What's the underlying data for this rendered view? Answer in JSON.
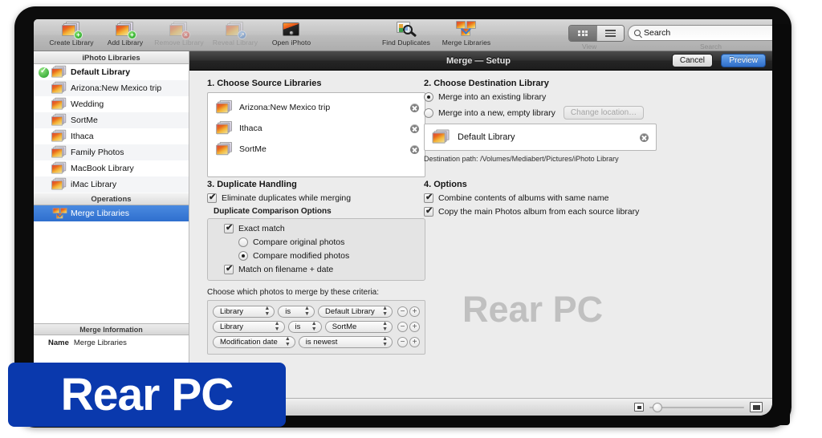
{
  "toolbar": {
    "items": [
      {
        "label": "Create Library",
        "icon": "photo-stack-add-icon",
        "enabled": true
      },
      {
        "label": "Add Library",
        "icon": "photo-stack-add-icon",
        "enabled": true
      },
      {
        "label": "Remove Library",
        "icon": "photo-stack-remove-icon",
        "enabled": false
      },
      {
        "label": "Reveal Library",
        "icon": "photo-stack-reveal-icon",
        "enabled": false
      },
      {
        "label": "Open iPhoto",
        "icon": "camera-icon",
        "enabled": true
      },
      {
        "label": "Find Duplicates",
        "icon": "magnifier-icon",
        "enabled": true
      },
      {
        "label": "Merge Libraries",
        "icon": "merge-icon",
        "enabled": true
      }
    ],
    "view_label": "View",
    "search_label": "Search",
    "search_value": "Search"
  },
  "sidebar": {
    "libraries_header": "iPhoto Libraries",
    "libraries": [
      {
        "name": "Default Library",
        "checked": true,
        "bold": true
      },
      {
        "name": "Arizona:New Mexico trip",
        "checked": false,
        "bold": false
      },
      {
        "name": "Wedding",
        "checked": false,
        "bold": false
      },
      {
        "name": "SortMe",
        "checked": false,
        "bold": false
      },
      {
        "name": "Ithaca",
        "checked": false,
        "bold": false
      },
      {
        "name": "Family Photos",
        "checked": false,
        "bold": false
      },
      {
        "name": "MacBook Library",
        "checked": false,
        "bold": false
      },
      {
        "name": "iMac Library",
        "checked": false,
        "bold": false
      }
    ],
    "operations_header": "Operations",
    "operations": [
      {
        "name": "Merge Libraries",
        "selected": true
      }
    ],
    "info_header": "Merge Information",
    "info_key": "Name",
    "info_value": "Merge Libraries"
  },
  "window": {
    "title": "Merge — Setup",
    "cancel_label": "Cancel",
    "preview_label": "Preview"
  },
  "section1": {
    "title": "1. Choose Source Libraries",
    "sources": [
      {
        "name": "Arizona:New Mexico trip"
      },
      {
        "name": "Ithaca"
      },
      {
        "name": "SortMe"
      }
    ]
  },
  "section2": {
    "title": "2. Choose Destination Library",
    "radio_existing": "Merge into an existing library",
    "radio_new": "Merge into a new, empty library",
    "existing_selected": true,
    "change_location_label": "Change location…",
    "destination_name": "Default Library",
    "destination_path_label": "Destination path:",
    "destination_path": "/Volumes/Mediabert/Pictures/iPhoto Library"
  },
  "section3": {
    "title": "3. Duplicate Handling",
    "eliminate_label": "Eliminate duplicates while merging",
    "eliminate_checked": true,
    "comparison_header": "Duplicate Comparison Options",
    "exact_match_label": "Exact match",
    "exact_match_checked": true,
    "compare_original_label": "Compare original photos",
    "compare_modified_label": "Compare modified photos",
    "compare_selected": "modified",
    "match_filename_label": "Match on filename + date",
    "match_filename_checked": true,
    "criteria_label": "Choose which photos to merge by these criteria:",
    "criteria_rows": [
      {
        "field": "Library",
        "operator": "is",
        "value": "Default Library"
      },
      {
        "field": "Library",
        "operator": "is",
        "value": "SortMe"
      },
      {
        "field": "Modification date",
        "operator": "is newest",
        "value": ""
      }
    ],
    "minus_label": "−",
    "plus_label": "+"
  },
  "section4": {
    "title": "4. Options",
    "options": [
      {
        "label": "Combine contents of albums with same name",
        "checked": true
      },
      {
        "label": "Copy the main Photos album from each source library",
        "checked": true
      }
    ]
  },
  "watermark": {
    "overlay_text": "Rear PC",
    "logo_text": "Rear PC"
  },
  "colors": {
    "accent_blue": "#2f6fce",
    "logo_blue": "#0a39ad",
    "selection_blue": "#3875d7",
    "titlebar_dark": "#2e2e2e"
  }
}
